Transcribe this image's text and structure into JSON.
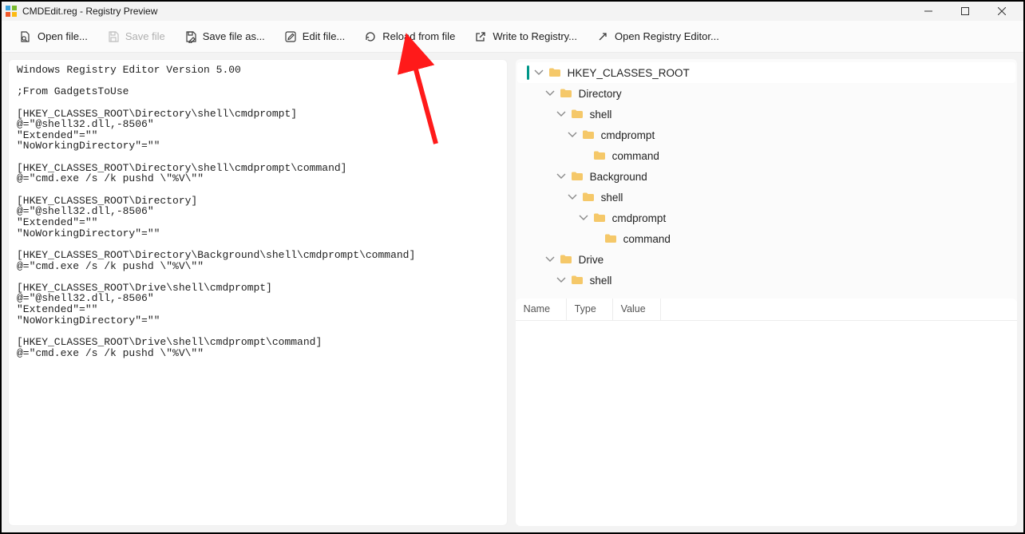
{
  "window": {
    "title": "CMDEdit.reg - Registry Preview"
  },
  "toolbar": {
    "open": "Open file...",
    "save": "Save file",
    "save_as": "Save file as...",
    "edit": "Edit file...",
    "reload": "Reload from file",
    "write": "Write to Registry...",
    "open_editor": "Open Registry Editor..."
  },
  "editor_text": "Windows Registry Editor Version 5.00\n\n;From GadgetsToUse\n\n[HKEY_CLASSES_ROOT\\Directory\\shell\\cmdprompt]\n@=\"@shell32.dll,-8506\"\n\"Extended\"=\"\"\n\"NoWorkingDirectory\"=\"\"\n\n[HKEY_CLASSES_ROOT\\Directory\\shell\\cmdprompt\\command]\n@=\"cmd.exe /s /k pushd \\\"%V\\\"\"\n\n[HKEY_CLASSES_ROOT\\Directory]\n@=\"@shell32.dll,-8506\"\n\"Extended\"=\"\"\n\"NoWorkingDirectory\"=\"\"\n\n[HKEY_CLASSES_ROOT\\Directory\\Background\\shell\\cmdprompt\\command]\n@=\"cmd.exe /s /k pushd \\\"%V\\\"\"\n\n[HKEY_CLASSES_ROOT\\Drive\\shell\\cmdprompt]\n@=\"@shell32.dll,-8506\"\n\"Extended\"=\"\"\n\"NoWorkingDirectory\"=\"\"\n\n[HKEY_CLASSES_ROOT\\Drive\\shell\\cmdprompt\\command]\n@=\"cmd.exe /s /k pushd \\\"%V\\\"\"",
  "tree": [
    {
      "label": "HKEY_CLASSES_ROOT",
      "depth": 0,
      "chev": true,
      "selected": true
    },
    {
      "label": "Directory",
      "depth": 1,
      "chev": true
    },
    {
      "label": "shell",
      "depth": 2,
      "chev": true
    },
    {
      "label": "cmdprompt",
      "depth": 3,
      "chev": true
    },
    {
      "label": "command",
      "depth": 4,
      "chev": false
    },
    {
      "label": "Background",
      "depth": 2,
      "chev": true
    },
    {
      "label": "shell",
      "depth": 3,
      "chev": true
    },
    {
      "label": "cmdprompt",
      "depth": 4,
      "chev": true
    },
    {
      "label": "command",
      "depth": 5,
      "chev": false
    },
    {
      "label": "Drive",
      "depth": 1,
      "chev": true
    },
    {
      "label": "shell",
      "depth": 2,
      "chev": true
    }
  ],
  "values_header": {
    "name": "Name",
    "type": "Type",
    "value": "Value"
  },
  "colors": {
    "accent": "#009688",
    "folder": "#f5c869"
  }
}
